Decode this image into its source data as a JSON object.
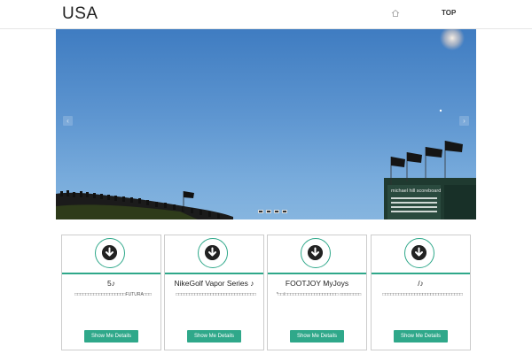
{
  "navbar": {
    "brand": "USA",
    "home_icon": "home-icon",
    "top_label": "TOP"
  },
  "hero": {
    "scoreboard_text": "michael hill scoreboard",
    "indicator_count": 4,
    "active_indicator": 0
  },
  "colors": {
    "accent": "#2fa88a",
    "sky": "#5d95d0"
  },
  "cards": [
    {
      "icon": "download-circle-icon",
      "title": "5♪",
      "desc": "□□□□□□□□□□□□□□□□□□□FUTURA□□□",
      "button": "Show Me Details"
    },
    {
      "icon": "download-circle-icon",
      "title": "NikeGolf Vapor Series ♪",
      "desc": "□□□□□□□□□□□□□□□□□□□□□□□□□□□□□□",
      "button": "Show Me Details"
    },
    {
      "icon": "download-circle-icon",
      "title": "FOOTJOY MyJoys",
      "desc": "*□□/□□□□□□□□□□□□□□□□□□□□ □□□□□□□□",
      "button": "Show Me Details"
    },
    {
      "icon": "download-circle-icon",
      "title": "/♪",
      "desc": "□□□□□□□□□□□□□□□□□□□□□□□□□□□□□□",
      "button": "Show Me Details"
    }
  ]
}
